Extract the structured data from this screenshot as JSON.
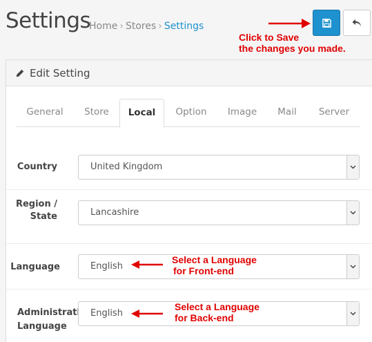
{
  "header": {
    "title": "Settings",
    "breadcrumb": [
      "Home",
      "Stores",
      "Settings"
    ],
    "breadcrumb_sep": "›",
    "save_annotation_line1": "Click to Save",
    "save_annotation_line2": "the changes you made."
  },
  "panel": {
    "heading": "Edit Setting",
    "tabs": [
      {
        "label": "General",
        "active": false
      },
      {
        "label": "Store",
        "active": false
      },
      {
        "label": "Local",
        "active": true
      },
      {
        "label": "Option",
        "active": false
      },
      {
        "label": "Image",
        "active": false
      },
      {
        "label": "Mail",
        "active": false
      },
      {
        "label": "Server",
        "active": false
      }
    ]
  },
  "form": {
    "country": {
      "label": "Country",
      "value": "United Kingdom"
    },
    "region": {
      "label_line1": "Region /",
      "label_line2": "State",
      "value": "Lancashire"
    },
    "language": {
      "label": "Language",
      "value": "English",
      "annotation_line1": "Select a Language",
      "annotation_line2": "for Front-end"
    },
    "admin_language": {
      "label_line1": "Administratio",
      "label_line2": "Language",
      "value": "English",
      "annotation_line1": "Select a Language",
      "annotation_line2": "for Back-end"
    }
  },
  "colors": {
    "primary": "#1e91cf",
    "annotation": "#e00000"
  },
  "icons": {
    "save": "floppy-disk-icon",
    "back": "reply-arrow-icon",
    "edit": "pencil-icon",
    "dropdown": "chevron-down-icon"
  }
}
